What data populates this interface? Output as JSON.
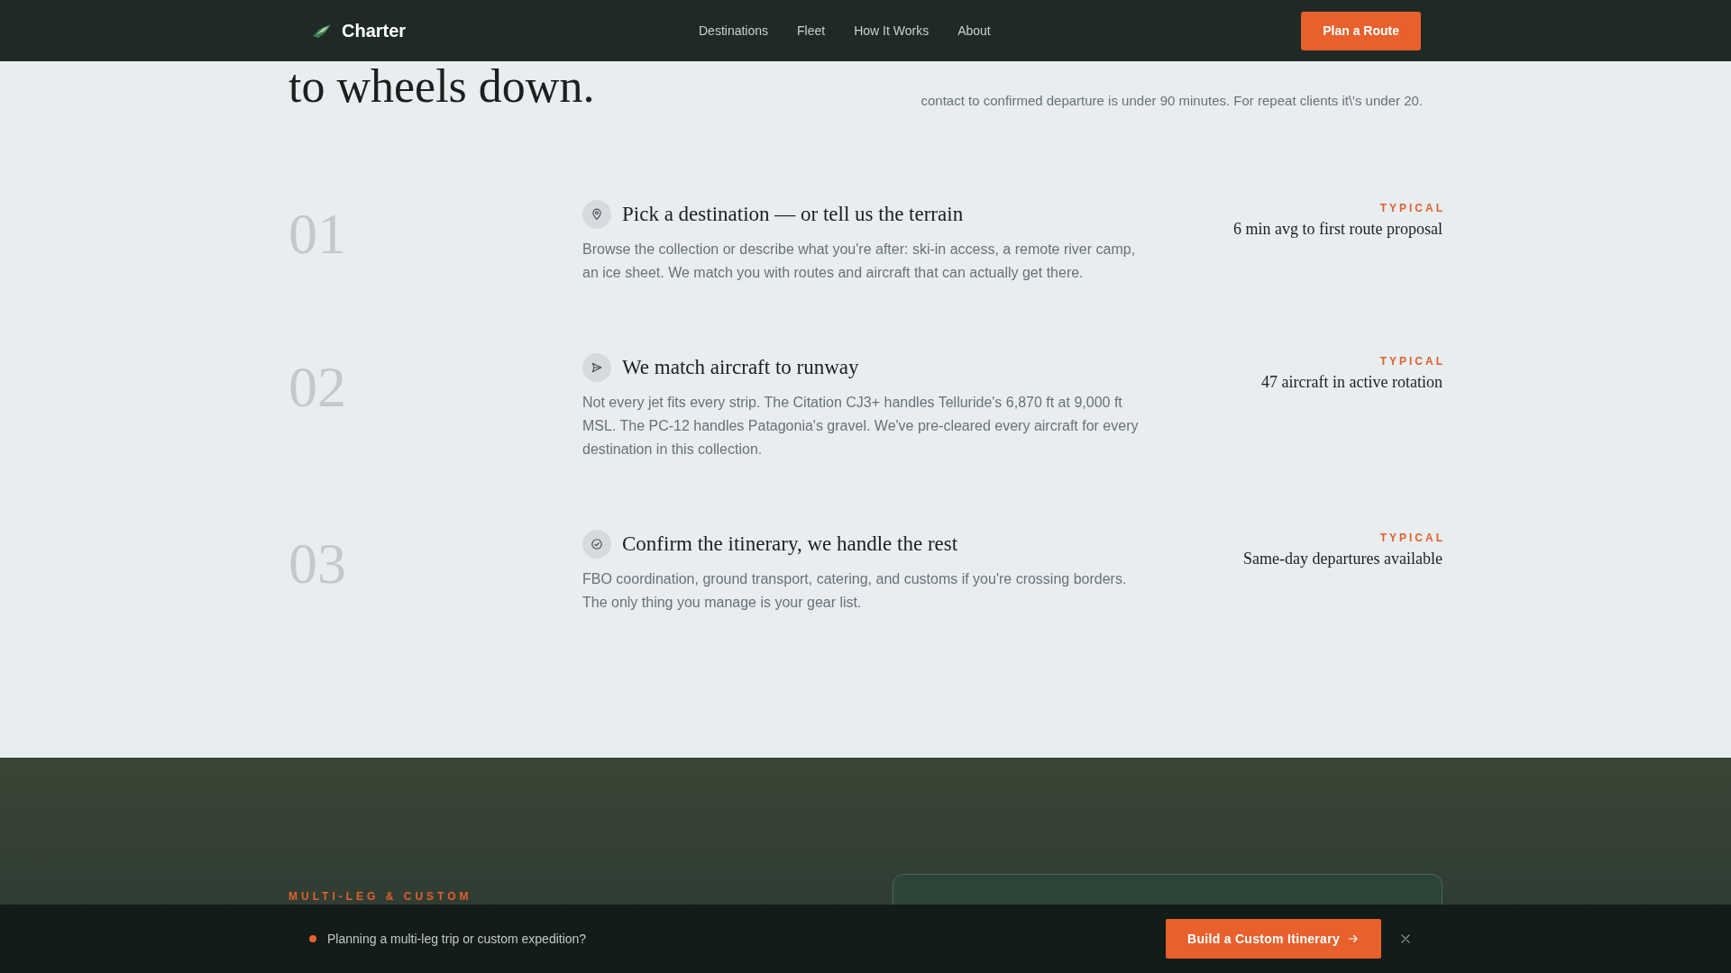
{
  "nav": {
    "brand": "Charter",
    "links": [
      "Destinations",
      "Fleet",
      "How It Works",
      "About"
    ],
    "cta": "Plan a Route"
  },
  "hero": {
    "title": "to wheels down.",
    "text": "contact to confirmed departure is under 90 minutes. For repeat clients it\\'s under 20."
  },
  "steps": [
    {
      "number": "01",
      "kind": "pin",
      "title": "Pick a destination — or tell us the terrain",
      "text": "Browse the collection or describe what you're after: ski-in access, a remote river camp, an ice sheet. We match you with routes and aircraft that can actually get there.",
      "label": "TYPICAL",
      "stat": "6 min avg to first route proposal"
    },
    {
      "number": "02",
      "kind": "send",
      "title": "We match aircraft to runway",
      "text": "Not every jet fits every strip. The Citation CJ3+ handles Telluride's 6,870 ft at 9,000 ft MSL. The PC-12 handles Patagonia's gravel. We've pre-cleared every aircraft for every destination in this collection.",
      "label": "TYPICAL",
      "stat": "47 aircraft in active rotation"
    },
    {
      "number": "03",
      "kind": "check",
      "title": "Confirm the itinerary, we handle the rest",
      "text": "FBO coordination, ground transport, catering, and customs if you're crossing borders. The only thing you manage is your gear list.",
      "label": "TYPICAL",
      "stat": "Same-day departures available"
    }
  ],
  "custom": {
    "eyebrow": "MULTI-LEG & CUSTOM"
  },
  "banner": {
    "text": "Planning a multi-leg trip or custom expedition?",
    "button": "Build a Custom Itinerary"
  }
}
